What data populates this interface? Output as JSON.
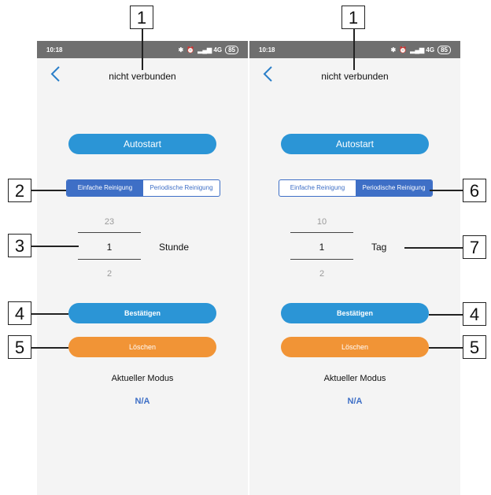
{
  "left": {
    "status_time": "10:18",
    "status_battery": "85",
    "title": "nicht verbunden",
    "autostart_label": "Autostart",
    "mode_tabs": [
      {
        "label": "Einfache Reinigung",
        "active": true
      },
      {
        "label": "Periodische Reinigung",
        "active": false
      }
    ],
    "picker": {
      "above": "23",
      "selected": "1",
      "below": "2",
      "unit": "Stunde"
    },
    "confirm_label": "Bestätigen",
    "delete_label": "Löschen",
    "current_mode_label": "Aktueller Modus",
    "current_mode_value": "N/A"
  },
  "right": {
    "status_time": "10:18",
    "status_battery": "85",
    "title": "nicht verbunden",
    "autostart_label": "Autostart",
    "mode_tabs": [
      {
        "label": "Einfache Reinigung",
        "active": false
      },
      {
        "label": "Periodische Reinigung",
        "active": true
      }
    ],
    "picker": {
      "above": "10",
      "selected": "1",
      "below": "2",
      "unit": "Tag"
    },
    "confirm_label": "Bestätigen",
    "delete_label": "Löschen",
    "current_mode_label": "Aktueller Modus",
    "current_mode_value": "N/A"
  },
  "callouts": {
    "title_left": "1",
    "title_right": "1",
    "mode_left": "2",
    "picker_left": "3",
    "confirm_left": "4",
    "delete_left": "5",
    "mode_right": "6",
    "picker_right": "7",
    "confirm_right": "4",
    "delete_right": "5"
  },
  "colors": {
    "primary_blue": "#2b95d6",
    "tab_blue": "#3e6fc6",
    "delete_orange": "#f19436",
    "statusbar_gray": "#6f6f6f"
  }
}
